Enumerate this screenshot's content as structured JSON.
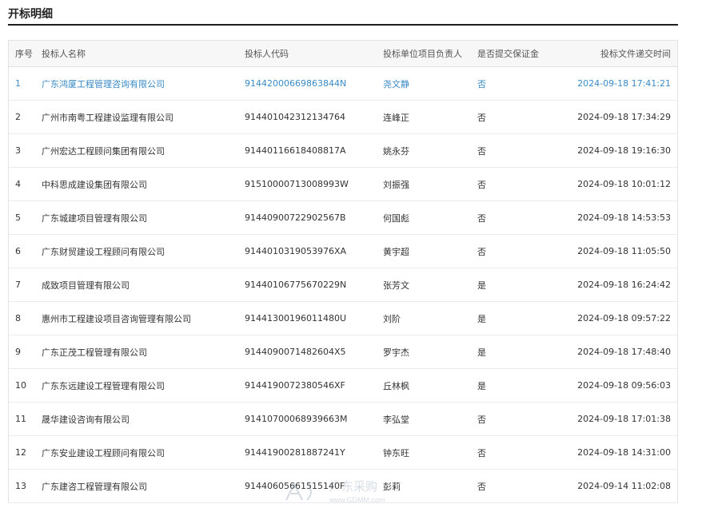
{
  "section": {
    "title": "开标明细"
  },
  "table": {
    "headers": {
      "no": "序号",
      "name": "投标人名称",
      "code": "投标人代码",
      "person": "投标单位项目负责人",
      "deposit": "是否提交保证金",
      "time": "投标文件递交时间"
    },
    "rows": [
      {
        "no": "1",
        "name": "广东鸿厦工程管理咨询有限公司",
        "code": "91442000669863844N",
        "person": "尧文静",
        "deposit": "否",
        "time": "2024-09-18 17:41:21"
      },
      {
        "no": "2",
        "name": "广州市南粤工程建设监理有限公司",
        "code": "914401042312134764",
        "person": "连峰正",
        "deposit": "否",
        "time": "2024-09-18 17:34:29"
      },
      {
        "no": "3",
        "name": "广州宏达工程顾问集团有限公司",
        "code": "91440116618408817A",
        "person": "姚永芬",
        "deposit": "否",
        "time": "2024-09-18 19:16:30"
      },
      {
        "no": "4",
        "name": "中科思成建设集团有限公司",
        "code": "91510000713008993W",
        "person": "刘振强",
        "deposit": "否",
        "time": "2024-09-18 10:01:12"
      },
      {
        "no": "5",
        "name": "广东城建项目管理有限公司",
        "code": "91440900722902567B",
        "person": "何国彪",
        "deposit": "否",
        "time": "2024-09-18 14:53:53"
      },
      {
        "no": "6",
        "name": "广东财贸建设工程顾问有限公司",
        "code": "9144010319053976XA",
        "person": "黄宇超",
        "deposit": "否",
        "time": "2024-09-18 11:05:50"
      },
      {
        "no": "7",
        "name": "成致项目管理有限公司",
        "code": "91440106775670229N",
        "person": "张芳文",
        "deposit": "是",
        "time": "2024-09-18 16:24:42"
      },
      {
        "no": "8",
        "name": "惠州市工程建设项目咨询管理有限公司",
        "code": "91441300196011480U",
        "person": "刘阶",
        "deposit": "是",
        "time": "2024-09-18 09:57:22"
      },
      {
        "no": "9",
        "name": "广东正茂工程管理有限公司",
        "code": "914409007148260​4X5",
        "person": "罗宇杰",
        "deposit": "是",
        "time": "2024-09-18 17:48:40"
      },
      {
        "no": "10",
        "name": "广东东远建设工程管理有限公司",
        "code": "9144190072380546XF",
        "person": "丘林枫",
        "deposit": "是",
        "time": "2024-09-18 09:56:03"
      },
      {
        "no": "11",
        "name": "晟华建设咨询有限公司",
        "code": "91410700068939663M",
        "person": "李弘堂",
        "deposit": "否",
        "time": "2024-09-18 17:01:38"
      },
      {
        "no": "12",
        "name": "广东安业建设工程顾问有限公司",
        "code": "91441900281887241Y",
        "person": "钟东旺",
        "deposit": "否",
        "time": "2024-09-18 14:31:00"
      },
      {
        "no": "13",
        "name": "广东建咨工程管理有限公司",
        "code": "91440605661515140F",
        "person": "彭莉",
        "deposit": "否",
        "time": "2024-09-14 11:02:08"
      }
    ]
  },
  "watermark": {
    "text": "www.GDMM.com",
    "logo_text": "广东采购"
  },
  "colors": {
    "link": "#3a8ac6",
    "header_bg": "#f7f7f7",
    "title_rule": "#1e1e1e"
  }
}
